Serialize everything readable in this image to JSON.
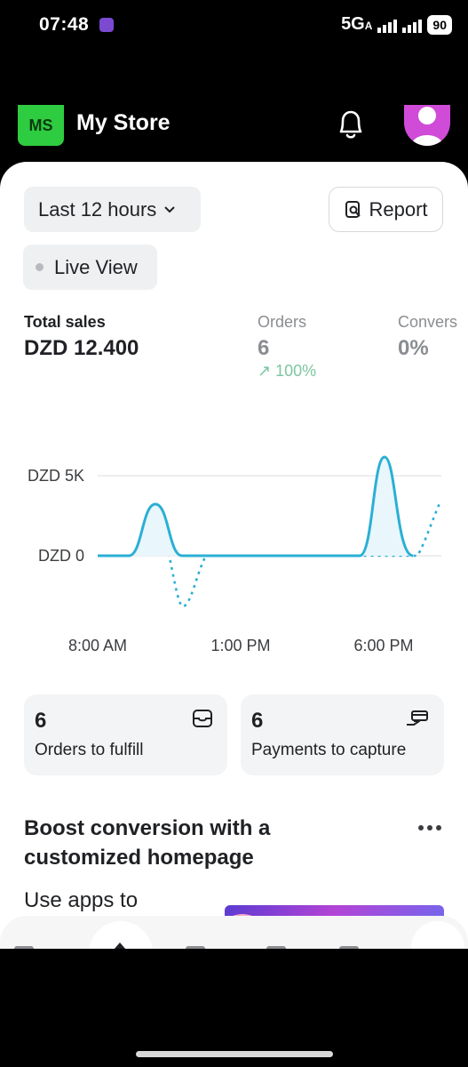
{
  "status_bar": {
    "time": "07:48",
    "network": "5G",
    "network_sub": "A",
    "battery": "90"
  },
  "header": {
    "store_initials": "MS",
    "store_name": "My Store"
  },
  "filters": {
    "range_label": "Last 12 hours",
    "live_label": "Live View",
    "report_label": "Report"
  },
  "metrics": {
    "total_sales_label": "Total sales",
    "total_sales_value": "DZD 12.400",
    "orders_label": "Orders",
    "orders_value": "6",
    "orders_change": "100%",
    "conversion_label": "Convers",
    "conversion_value": "0%"
  },
  "chart_data": {
    "type": "line",
    "x_ticks": [
      "8:00 AM",
      "1:00 PM",
      "6:00 PM"
    ],
    "y_ticks": [
      "DZD 5K",
      "DZD 0"
    ],
    "series": [],
    "grid": true
  },
  "cards": [
    {
      "value": "6",
      "label": "Orders to fulfill",
      "icon": "inbox-icon"
    },
    {
      "value": "6",
      "label": "Payments to capture",
      "icon": "hand-card-icon"
    }
  ],
  "boost": {
    "title": "Boost conversion with a customized homepage",
    "body": "Use apps to design"
  }
}
